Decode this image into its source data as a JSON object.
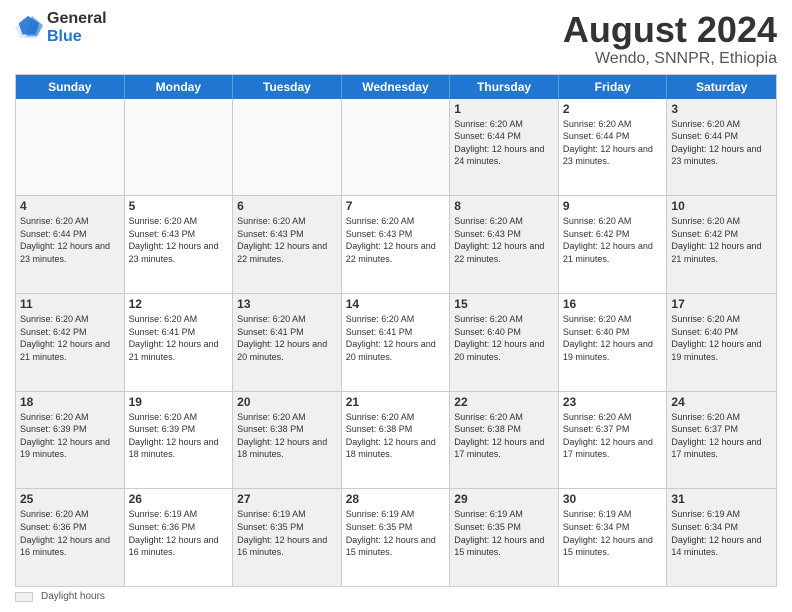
{
  "logo": {
    "general": "General",
    "blue": "Blue"
  },
  "title": "August 2024",
  "subtitle": "Wendo, SNNPR, Ethiopia",
  "days_of_week": [
    "Sunday",
    "Monday",
    "Tuesday",
    "Wednesday",
    "Thursday",
    "Friday",
    "Saturday"
  ],
  "footer": {
    "swatch_label": "Daylight hours"
  },
  "weeks": [
    [
      {
        "day": "",
        "info": "",
        "empty": true
      },
      {
        "day": "",
        "info": "",
        "empty": true
      },
      {
        "day": "",
        "info": "",
        "empty": true
      },
      {
        "day": "",
        "info": "",
        "empty": true
      },
      {
        "day": "1",
        "info": "Sunrise: 6:20 AM\nSunset: 6:44 PM\nDaylight: 12 hours\nand 24 minutes.",
        "empty": false
      },
      {
        "day": "2",
        "info": "Sunrise: 6:20 AM\nSunset: 6:44 PM\nDaylight: 12 hours\nand 23 minutes.",
        "empty": false
      },
      {
        "day": "3",
        "info": "Sunrise: 6:20 AM\nSunset: 6:44 PM\nDaylight: 12 hours\nand 23 minutes.",
        "empty": false
      }
    ],
    [
      {
        "day": "4",
        "info": "Sunrise: 6:20 AM\nSunset: 6:44 PM\nDaylight: 12 hours\nand 23 minutes.",
        "empty": false
      },
      {
        "day": "5",
        "info": "Sunrise: 6:20 AM\nSunset: 6:43 PM\nDaylight: 12 hours\nand 23 minutes.",
        "empty": false
      },
      {
        "day": "6",
        "info": "Sunrise: 6:20 AM\nSunset: 6:43 PM\nDaylight: 12 hours\nand 22 minutes.",
        "empty": false
      },
      {
        "day": "7",
        "info": "Sunrise: 6:20 AM\nSunset: 6:43 PM\nDaylight: 12 hours\nand 22 minutes.",
        "empty": false
      },
      {
        "day": "8",
        "info": "Sunrise: 6:20 AM\nSunset: 6:43 PM\nDaylight: 12 hours\nand 22 minutes.",
        "empty": false
      },
      {
        "day": "9",
        "info": "Sunrise: 6:20 AM\nSunset: 6:42 PM\nDaylight: 12 hours\nand 21 minutes.",
        "empty": false
      },
      {
        "day": "10",
        "info": "Sunrise: 6:20 AM\nSunset: 6:42 PM\nDaylight: 12 hours\nand 21 minutes.",
        "empty": false
      }
    ],
    [
      {
        "day": "11",
        "info": "Sunrise: 6:20 AM\nSunset: 6:42 PM\nDaylight: 12 hours\nand 21 minutes.",
        "empty": false
      },
      {
        "day": "12",
        "info": "Sunrise: 6:20 AM\nSunset: 6:41 PM\nDaylight: 12 hours\nand 21 minutes.",
        "empty": false
      },
      {
        "day": "13",
        "info": "Sunrise: 6:20 AM\nSunset: 6:41 PM\nDaylight: 12 hours\nand 20 minutes.",
        "empty": false
      },
      {
        "day": "14",
        "info": "Sunrise: 6:20 AM\nSunset: 6:41 PM\nDaylight: 12 hours\nand 20 minutes.",
        "empty": false
      },
      {
        "day": "15",
        "info": "Sunrise: 6:20 AM\nSunset: 6:40 PM\nDaylight: 12 hours\nand 20 minutes.",
        "empty": false
      },
      {
        "day": "16",
        "info": "Sunrise: 6:20 AM\nSunset: 6:40 PM\nDaylight: 12 hours\nand 19 minutes.",
        "empty": false
      },
      {
        "day": "17",
        "info": "Sunrise: 6:20 AM\nSunset: 6:40 PM\nDaylight: 12 hours\nand 19 minutes.",
        "empty": false
      }
    ],
    [
      {
        "day": "18",
        "info": "Sunrise: 6:20 AM\nSunset: 6:39 PM\nDaylight: 12 hours\nand 19 minutes.",
        "empty": false
      },
      {
        "day": "19",
        "info": "Sunrise: 6:20 AM\nSunset: 6:39 PM\nDaylight: 12 hours\nand 18 minutes.",
        "empty": false
      },
      {
        "day": "20",
        "info": "Sunrise: 6:20 AM\nSunset: 6:38 PM\nDaylight: 12 hours\nand 18 minutes.",
        "empty": false
      },
      {
        "day": "21",
        "info": "Sunrise: 6:20 AM\nSunset: 6:38 PM\nDaylight: 12 hours\nand 18 minutes.",
        "empty": false
      },
      {
        "day": "22",
        "info": "Sunrise: 6:20 AM\nSunset: 6:38 PM\nDaylight: 12 hours\nand 17 minutes.",
        "empty": false
      },
      {
        "day": "23",
        "info": "Sunrise: 6:20 AM\nSunset: 6:37 PM\nDaylight: 12 hours\nand 17 minutes.",
        "empty": false
      },
      {
        "day": "24",
        "info": "Sunrise: 6:20 AM\nSunset: 6:37 PM\nDaylight: 12 hours\nand 17 minutes.",
        "empty": false
      }
    ],
    [
      {
        "day": "25",
        "info": "Sunrise: 6:20 AM\nSunset: 6:36 PM\nDaylight: 12 hours\nand 16 minutes.",
        "empty": false
      },
      {
        "day": "26",
        "info": "Sunrise: 6:19 AM\nSunset: 6:36 PM\nDaylight: 12 hours\nand 16 minutes.",
        "empty": false
      },
      {
        "day": "27",
        "info": "Sunrise: 6:19 AM\nSunset: 6:35 PM\nDaylight: 12 hours\nand 16 minutes.",
        "empty": false
      },
      {
        "day": "28",
        "info": "Sunrise: 6:19 AM\nSunset: 6:35 PM\nDaylight: 12 hours\nand 15 minutes.",
        "empty": false
      },
      {
        "day": "29",
        "info": "Sunrise: 6:19 AM\nSunset: 6:35 PM\nDaylight: 12 hours\nand 15 minutes.",
        "empty": false
      },
      {
        "day": "30",
        "info": "Sunrise: 6:19 AM\nSunset: 6:34 PM\nDaylight: 12 hours\nand 15 minutes.",
        "empty": false
      },
      {
        "day": "31",
        "info": "Sunrise: 6:19 AM\nSunset: 6:34 PM\nDaylight: 12 hours\nand 14 minutes.",
        "empty": false
      }
    ]
  ]
}
